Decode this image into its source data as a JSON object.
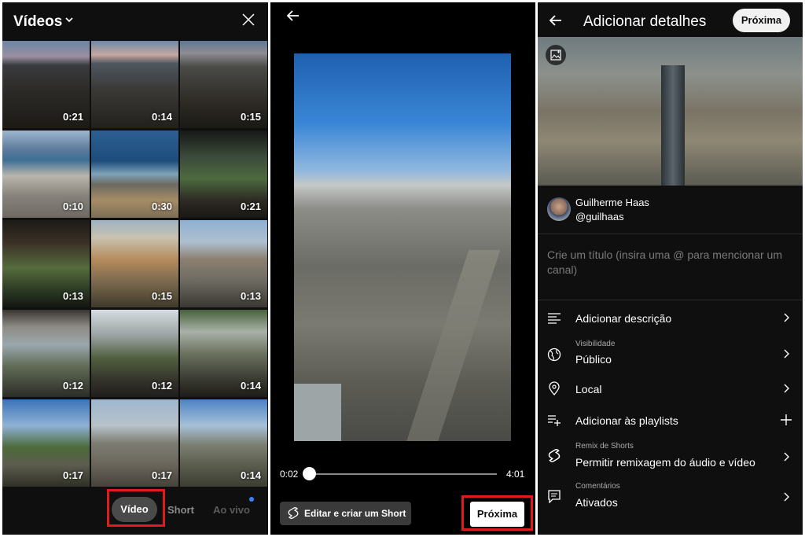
{
  "panel1": {
    "title": "Vídeos",
    "tiles": [
      {
        "duration": "0:21"
      },
      {
        "duration": "0:14"
      },
      {
        "duration": "0:15"
      },
      {
        "duration": "0:10"
      },
      {
        "duration": "0:30"
      },
      {
        "duration": "0:21"
      },
      {
        "duration": "0:13"
      },
      {
        "duration": "0:15"
      },
      {
        "duration": "0:13"
      },
      {
        "duration": "0:12"
      },
      {
        "duration": "0:12"
      },
      {
        "duration": "0:14"
      },
      {
        "duration": "0:17"
      },
      {
        "duration": "0:17"
      },
      {
        "duration": "0:14"
      }
    ],
    "tabs": {
      "video": "Vídeo",
      "short": "Short",
      "live": "Ao vivo"
    }
  },
  "panel2": {
    "time_start": "0:02",
    "time_end": "4:01",
    "edit_button": "Editar e criar um Short",
    "next_button": "Próxima"
  },
  "panel3": {
    "title": "Adicionar detalhes",
    "next_button": "Próxima",
    "channel_name": "Guilherme Haas",
    "channel_handle": "@guilhaas",
    "title_placeholder": "Crie um título (insira uma @ para mencionar um canal)",
    "rows": {
      "description": {
        "label": "Adicionar descrição"
      },
      "visibility": {
        "sublabel": "Visibilidade",
        "label": "Público"
      },
      "location": {
        "label": "Local"
      },
      "playlists": {
        "label": "Adicionar às playlists"
      },
      "remix": {
        "sublabel": "Remix de Shorts",
        "label": "Permitir remixagem do áudio e vídeo"
      },
      "comments": {
        "sublabel": "Comentários",
        "label": "Ativados"
      }
    }
  },
  "colors": {
    "highlight": "#e01b1b",
    "background": "#0f0f0f",
    "live_dot": "#3b82f6"
  }
}
